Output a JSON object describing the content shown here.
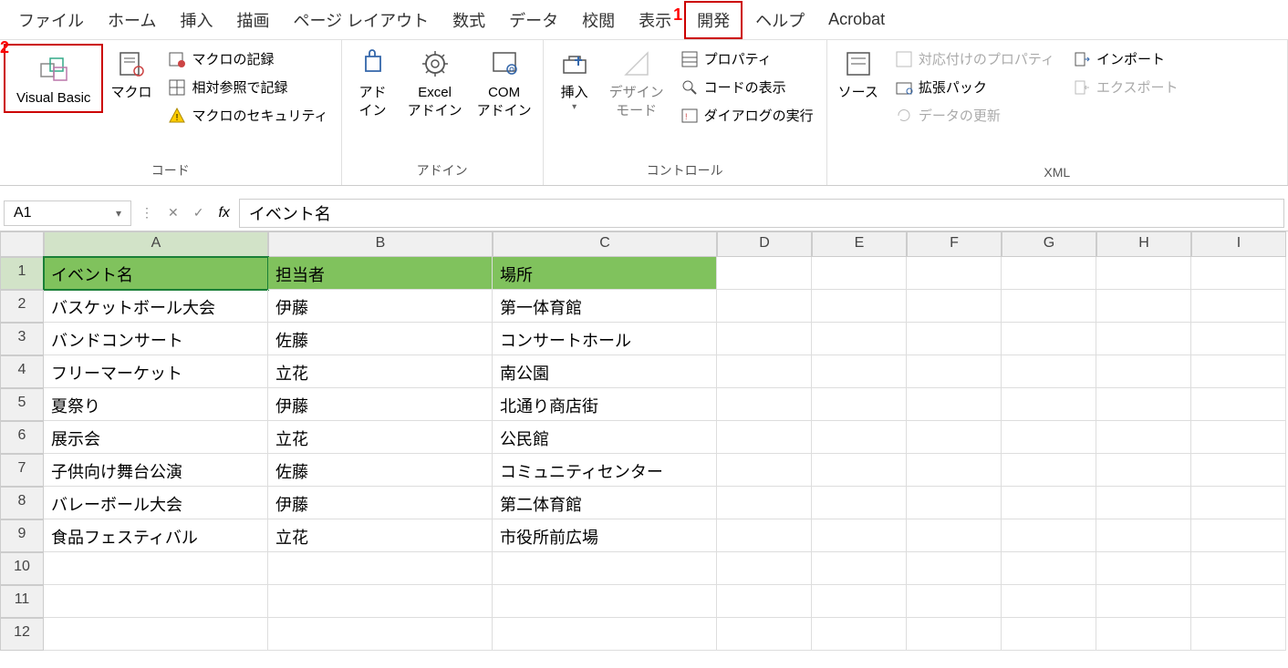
{
  "annotations": {
    "a1": "1",
    "a2": "2"
  },
  "menu": {
    "file": "ファイル",
    "home": "ホーム",
    "insert": "挿入",
    "draw": "描画",
    "pageLayout": "ページ レイアウト",
    "formulas": "数式",
    "data": "データ",
    "review": "校閲",
    "view": "表示",
    "developer": "開発",
    "help": "ヘルプ",
    "acrobat": "Acrobat"
  },
  "ribbon": {
    "code": {
      "label": "コード",
      "visualBasic": "Visual Basic",
      "macros": "マクロ",
      "recordMacro": "マクロの記録",
      "relativeRef": "相対参照で記録",
      "macroSecurity": "マクロのセキュリティ"
    },
    "addins": {
      "label": "アドイン",
      "addin": "アド\nイン",
      "excelAddin": "Excel\nアドイン",
      "comAddin": "COM\nアドイン"
    },
    "controls": {
      "label": "コントロール",
      "insert": "挿入",
      "designMode": "デザイン\nモード",
      "properties": "プロパティ",
      "viewCode": "コードの表示",
      "runDialog": "ダイアログの実行"
    },
    "xml": {
      "label": "XML",
      "source": "ソース",
      "mapProperties": "対応付けのプロパティ",
      "expansionPack": "拡張パック",
      "refreshData": "データの更新",
      "import": "インポート",
      "export": "エクスポート"
    }
  },
  "nameBox": "A1",
  "formula": "イベント名",
  "columns": [
    "A",
    "B",
    "C",
    "D",
    "E",
    "F",
    "G",
    "H",
    "I"
  ],
  "rows": [
    "1",
    "2",
    "3",
    "4",
    "5",
    "6",
    "7",
    "8",
    "9",
    "10",
    "11",
    "12"
  ],
  "table": {
    "headers": [
      "イベント名",
      "担当者",
      "場所"
    ],
    "data": [
      [
        "バスケットボール大会",
        "伊藤",
        "第一体育館"
      ],
      [
        "バンドコンサート",
        "佐藤",
        "コンサートホール"
      ],
      [
        "フリーマーケット",
        "立花",
        "南公園"
      ],
      [
        "夏祭り",
        "伊藤",
        "北通り商店街"
      ],
      [
        "展示会",
        "立花",
        "公民館"
      ],
      [
        "子供向け舞台公演",
        "佐藤",
        "コミュニティセンター"
      ],
      [
        "バレーボール大会",
        "伊藤",
        "第二体育館"
      ],
      [
        "食品フェスティバル",
        "立花",
        "市役所前広場"
      ]
    ]
  }
}
